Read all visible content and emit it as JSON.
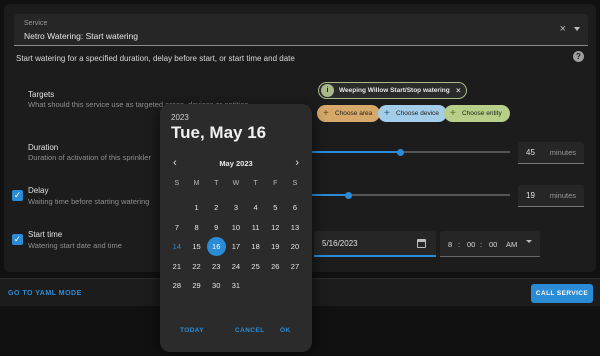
{
  "service": {
    "label": "Service",
    "value": "Netro Watering: Start watering",
    "clear_glyph": "×"
  },
  "description": "Start watering for a specified duration, delay before start, or start time and date",
  "help_glyph": "?",
  "targets": {
    "title": "Targets",
    "subtitle": "What should this service use as targeted areas, devices or entities",
    "chip_label": "Weeping Willow Start/Stop watering",
    "chip_avatar_glyph": "i",
    "chip_close_glyph": "×",
    "choose_area": "Choose area",
    "choose_device": "Choose device",
    "choose_entity": "Choose entity",
    "plus_glyph": "+"
  },
  "duration": {
    "title": "Duration",
    "subtitle": "Duration of activation of this sprinkler",
    "value": "45",
    "unit": "minutes",
    "slider_fraction": 0.45
  },
  "delay": {
    "title": "Delay",
    "subtitle": "Waiting time before starting watering",
    "value": "19",
    "unit": "minutes",
    "checked": true,
    "slider_fraction": 0.19
  },
  "start_time": {
    "title": "Start time",
    "subtitle": "Watering start date and time",
    "checked": true,
    "date_value": "5/16/2023",
    "time_hour": "8",
    "time_minute": "00",
    "time_second": "00",
    "time_period": "AM",
    "time_separator": ":"
  },
  "checkbox_glyph": "✓",
  "footer": {
    "yaml_link": "GO TO YAML MODE",
    "call_button": "CALL SERVICE"
  },
  "date_picker": {
    "year": "2023",
    "selected_date": "Tue, May 16",
    "month_label": "May 2023",
    "weekdays": [
      "S",
      "M",
      "T",
      "W",
      "T",
      "F",
      "S"
    ],
    "days": [
      "",
      "1",
      "2",
      "3",
      "4",
      "5",
      "6",
      "7",
      "8",
      "9",
      "10",
      "11",
      "12",
      "13",
      "14",
      "15",
      "16",
      "17",
      "18",
      "19",
      "20",
      "21",
      "22",
      "23",
      "24",
      "25",
      "26",
      "27",
      "28",
      "29",
      "30",
      "31",
      "",
      "",
      ""
    ],
    "today_day": "14",
    "selected_day": "16",
    "prev_glyph": "‹",
    "next_glyph": "›",
    "today_button": "TODAY",
    "cancel_button": "CANCEL",
    "ok_button": "OK"
  },
  "colors": {
    "accent": "#2a8cd6",
    "area_pill": "#d6a96a",
    "device_pill": "#a3cde8",
    "entity_pill": "#b7cf88"
  }
}
